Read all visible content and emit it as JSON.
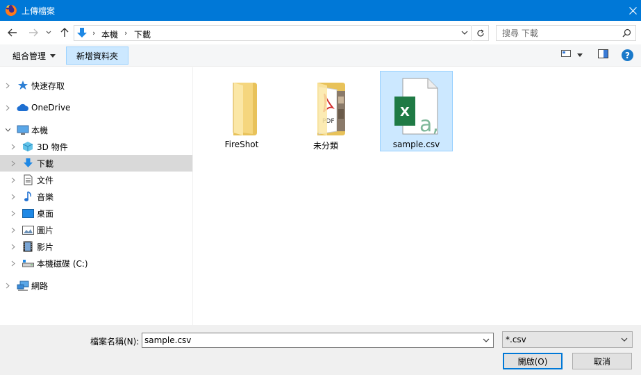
{
  "window": {
    "title": "上傳檔案"
  },
  "address": {
    "crumbs": [
      "本機",
      "下載"
    ]
  },
  "search": {
    "placeholder": "搜尋 下載"
  },
  "toolbar": {
    "organize_label": "組合管理",
    "new_folder_label": "新增資料夾",
    "help_label": "?"
  },
  "sidebar": {
    "items": [
      {
        "label": "快速存取",
        "icon": "star-icon"
      },
      {
        "label": "OneDrive",
        "icon": "cloud-icon"
      },
      {
        "label": "本機",
        "icon": "computer-icon"
      },
      {
        "label": "3D 物件",
        "icon": "cube-icon"
      },
      {
        "label": "下載",
        "icon": "download-icon"
      },
      {
        "label": "文件",
        "icon": "document-icon"
      },
      {
        "label": "音樂",
        "icon": "music-icon"
      },
      {
        "label": "桌面",
        "icon": "desktop-icon"
      },
      {
        "label": "圖片",
        "icon": "pictures-icon"
      },
      {
        "label": "影片",
        "icon": "video-icon"
      },
      {
        "label": "本機磁碟 (C:)",
        "icon": "drive-icon"
      },
      {
        "label": "網路",
        "icon": "network-icon"
      }
    ]
  },
  "files": [
    {
      "name": "FireShot",
      "icon": "folder-icon"
    },
    {
      "name": "未分類",
      "icon": "folder-pdf-icon"
    },
    {
      "name": "sample.csv",
      "icon": "excel-csv-icon"
    }
  ],
  "bottom": {
    "filename_label": "檔案名稱(N):",
    "filename_value": "sample.csv",
    "filter_value": "*.csv",
    "open_label": "開啟(O)",
    "cancel_label": "取消"
  }
}
